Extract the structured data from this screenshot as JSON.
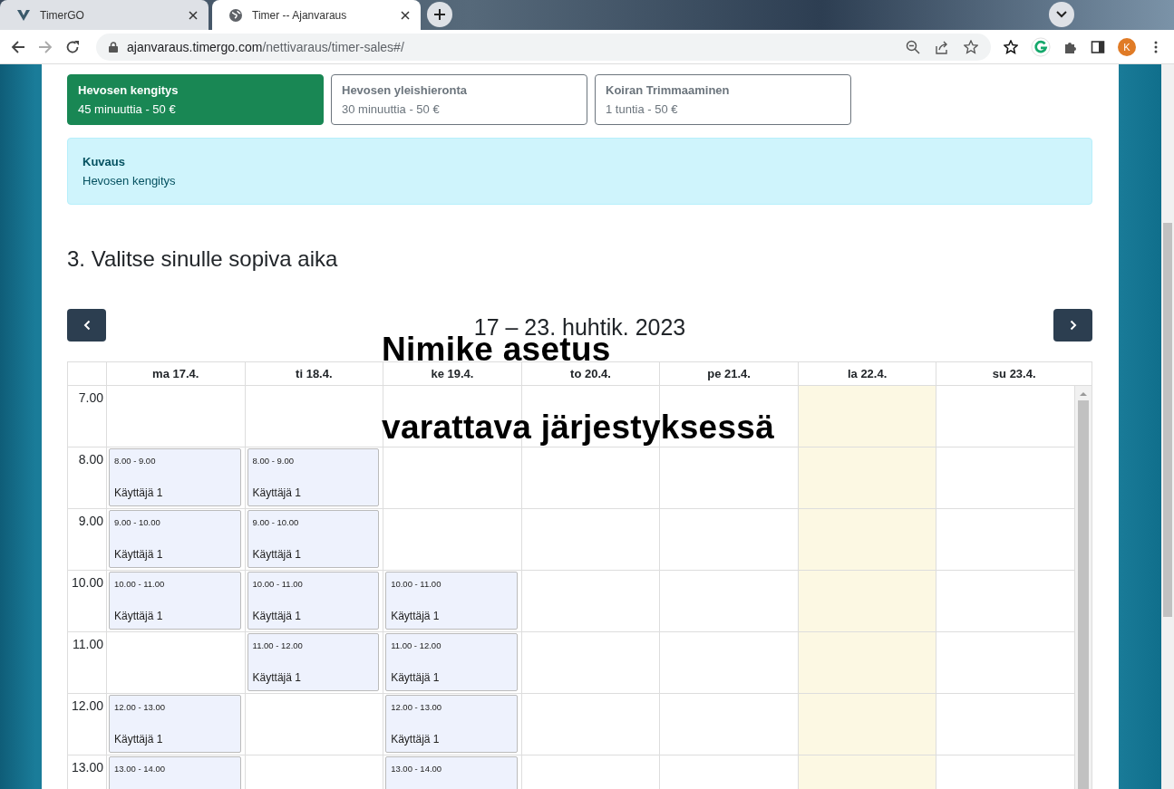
{
  "browser": {
    "tabs": [
      {
        "title": "TimerGO",
        "selected": false
      },
      {
        "title": "Timer -- Ajanvaraus",
        "selected": true
      }
    ],
    "url_host": "ajanvaraus.timergo.com",
    "url_path": "/nettivaraus/timer-sales#/",
    "profile_initial": "K"
  },
  "services": [
    {
      "name": "Hevosen kengitys",
      "detail": "45 minuuttia - 50 €",
      "selected": true
    },
    {
      "name": "Hevosen yleishieronta",
      "detail": "30 minuuttia - 50 €",
      "selected": false
    },
    {
      "name": "Koiran Trimmaaminen",
      "detail": "1 tuntia - 50 €",
      "selected": false
    }
  ],
  "description": {
    "title": "Kuvaus",
    "text": "Hevosen kengitys"
  },
  "step_heading": "3. Valitse sinulle sopiva aika",
  "calendar": {
    "title": "17 – 23. huhtik. 2023",
    "days": [
      {
        "label": "ma 17.4.",
        "today": false
      },
      {
        "label": "ti 18.4.",
        "today": false
      },
      {
        "label": "ke 19.4.",
        "today": false
      },
      {
        "label": "to 20.4.",
        "today": false
      },
      {
        "label": "pe 21.4.",
        "today": false
      },
      {
        "label": "la 22.4.",
        "today": true
      },
      {
        "label": "su 23.4.",
        "today": false
      }
    ],
    "rows": [
      {
        "time": "7.00",
        "cells": [
          null,
          null,
          null,
          null,
          null,
          null,
          null
        ]
      },
      {
        "time": "8.00",
        "cells": [
          {
            "time": "8.00 - 9.00",
            "name": "Käyttäjä 1"
          },
          {
            "time": "8.00 - 9.00",
            "name": "Käyttäjä 1"
          },
          null,
          null,
          null,
          null,
          null
        ]
      },
      {
        "time": "9.00",
        "cells": [
          {
            "time": "9.00 - 10.00",
            "name": "Käyttäjä 1"
          },
          {
            "time": "9.00 - 10.00",
            "name": "Käyttäjä 1"
          },
          null,
          null,
          null,
          null,
          null
        ]
      },
      {
        "time": "10.00",
        "cells": [
          {
            "time": "10.00 - 11.00",
            "name": "Käyttäjä 1"
          },
          {
            "time": "10.00 - 11.00",
            "name": "Käyttäjä 1"
          },
          {
            "time": "10.00 - 11.00",
            "name": "Käyttäjä 1"
          },
          null,
          null,
          null,
          null
        ]
      },
      {
        "time": "11.00",
        "cells": [
          null,
          {
            "time": "11.00 - 12.00",
            "name": "Käyttäjä 1"
          },
          {
            "time": "11.00 - 12.00",
            "name": "Käyttäjä 1"
          },
          null,
          null,
          null,
          null
        ]
      },
      {
        "time": "12.00",
        "cells": [
          {
            "time": "12.00 - 13.00",
            "name": "Käyttäjä 1"
          },
          null,
          {
            "time": "12.00 - 13.00",
            "name": "Käyttäjä 1"
          },
          null,
          null,
          null,
          null
        ]
      },
      {
        "time": "13.00",
        "cells": [
          {
            "time": "13.00 - 14.00"
          },
          null,
          {
            "time": "13.00 - 14.00"
          },
          null,
          null,
          null,
          null
        ]
      }
    ]
  },
  "captions": [
    "Nimike asetus",
    "varattava järjestyksessä"
  ]
}
